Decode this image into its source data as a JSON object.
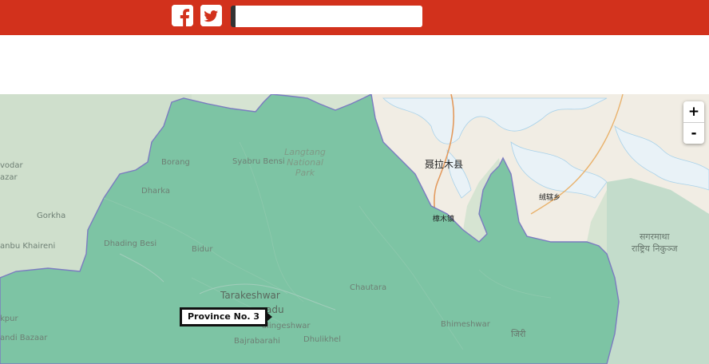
{
  "header": {
    "brand_color": "#d2311c",
    "social": [
      {
        "icon": "facebook-icon"
      },
      {
        "icon": "twitter-icon"
      }
    ],
    "search": {
      "value": ""
    }
  },
  "map": {
    "controls": {
      "zoom_in": "+",
      "zoom_out": "-"
    },
    "tooltip": "Province No. 3",
    "region_color": "#7dc4a4",
    "labels": {
      "vodar": "vodar",
      "azar": "azar",
      "borang": "Borang",
      "syabru_bensi": "Syabru Bensi",
      "langtang": "Langtang",
      "national": "National",
      "park": "Park",
      "dharka": "Dharka",
      "gorkha": "Gorkha",
      "anbu_khaireni": "anbu Khaireni",
      "dhading_besi": "Dhading Besi",
      "bidur": "Bidur",
      "tarakeshwar": "Tarakeshwar",
      "adu": "adu",
      "lalitpur": "alingeshwar",
      "bajrabarahi": "Bajrabarahi",
      "dhulikhel": "Dhulikhel",
      "chautara": "Chautara",
      "bhimeshwar": "Bhimeshwar",
      "kpur": "kpur",
      "andi_bazaar": "andi Bazaar",
      "nyalam": "聂拉木县",
      "zhangmu": "樟木镇",
      "rongxia": "绒辖乡",
      "sagarmatha": "सगरमाथा",
      "rastriya": "राष्ट्रिय निकुञ्ज",
      "jiri": "जिरी"
    }
  }
}
